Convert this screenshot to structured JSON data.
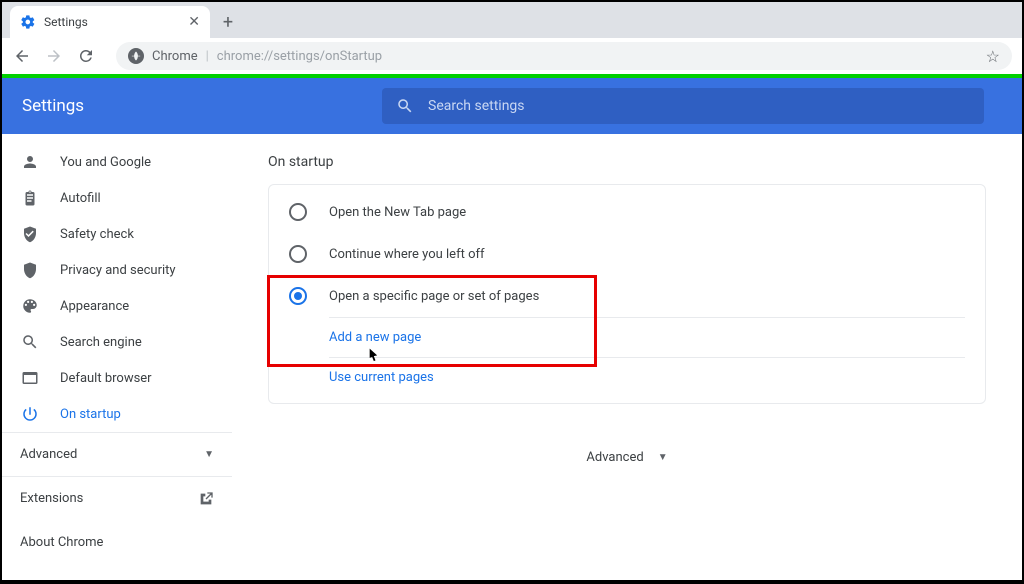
{
  "tab": {
    "title": "Settings"
  },
  "omnibox": {
    "prefix": "Chrome",
    "url": "chrome://settings/onStartup"
  },
  "header": {
    "title": "Settings",
    "search_placeholder": "Search settings"
  },
  "sidebar": {
    "items": [
      {
        "label": "You and Google"
      },
      {
        "label": "Autofill"
      },
      {
        "label": "Safety check"
      },
      {
        "label": "Privacy and security"
      },
      {
        "label": "Appearance"
      },
      {
        "label": "Search engine"
      },
      {
        "label": "Default browser"
      },
      {
        "label": "On startup"
      }
    ],
    "advanced": "Advanced",
    "extensions": "Extensions",
    "about": "About Chrome"
  },
  "main": {
    "section_title": "On startup",
    "options": [
      {
        "label": "Open the New Tab page"
      },
      {
        "label": "Continue where you left off"
      },
      {
        "label": "Open a specific page or set of pages"
      }
    ],
    "add_page": "Add a new page",
    "use_current": "Use current pages",
    "advanced": "Advanced"
  }
}
